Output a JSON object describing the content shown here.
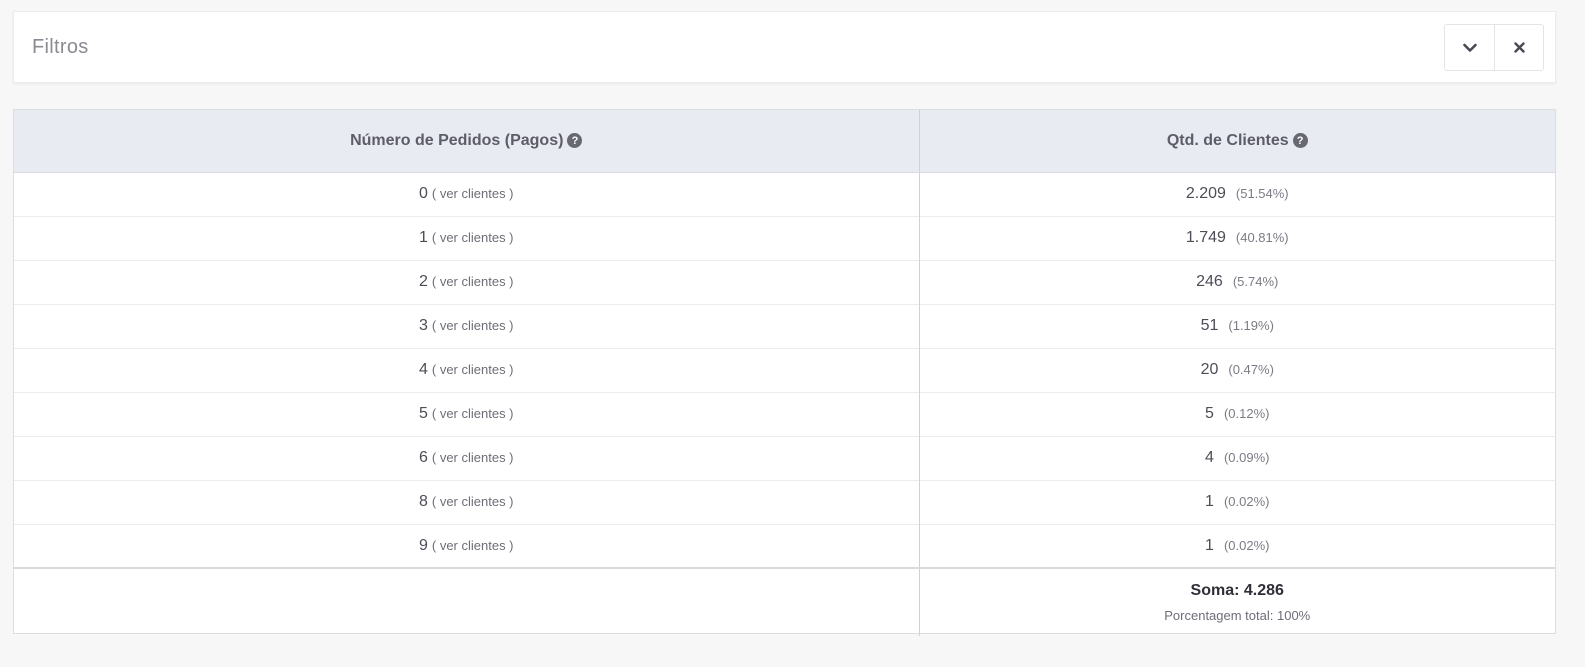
{
  "filters": {
    "title": "Filtros",
    "expand_icon": "chevron-down-icon",
    "close_icon": "close-icon"
  },
  "table": {
    "headers": [
      "Número de Pedidos (Pagos)",
      "Qtd. de Clientes"
    ],
    "help_icon": "question-circle-icon",
    "help_glyph": "?",
    "link_label": "( ver clientes )",
    "rows": [
      {
        "orders": "0",
        "clients": "2.209",
        "pct": "(51.54%)"
      },
      {
        "orders": "1",
        "clients": "1.749",
        "pct": "(40.81%)"
      },
      {
        "orders": "2",
        "clients": "246",
        "pct": "(5.74%)"
      },
      {
        "orders": "3",
        "clients": "51",
        "pct": "(1.19%)"
      },
      {
        "orders": "4",
        "clients": "20",
        "pct": "(0.47%)"
      },
      {
        "orders": "5",
        "clients": "5",
        "pct": "(0.12%)"
      },
      {
        "orders": "6",
        "clients": "4",
        "pct": "(0.09%)"
      },
      {
        "orders": "8",
        "clients": "1",
        "pct": "(0.02%)"
      },
      {
        "orders": "9",
        "clients": "1",
        "pct": "(0.02%)"
      }
    ],
    "footer": {
      "sum": "Soma: 4.286",
      "total": "Porcentagem total: 100%"
    }
  },
  "colors": {
    "header_bg": "#e9ebf3",
    "page_bg": "#f7f7f8",
    "icon": "#686873"
  }
}
